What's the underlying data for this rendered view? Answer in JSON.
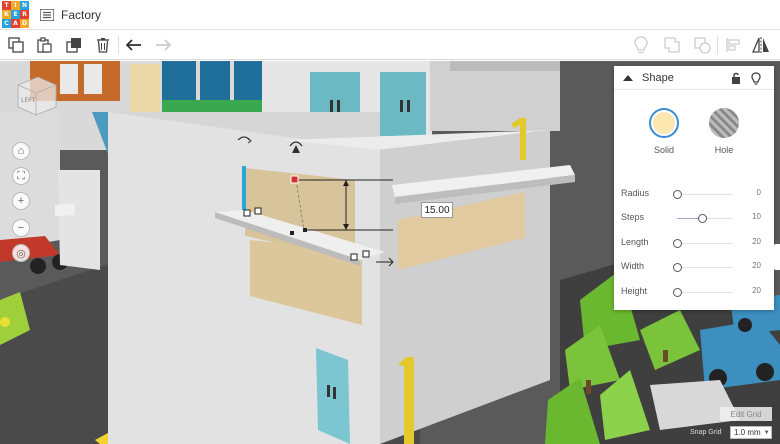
{
  "app": {
    "logo_letters": [
      "T",
      "I",
      "N",
      "K",
      "E",
      "R",
      "C",
      "A",
      "D"
    ],
    "logo_colors": [
      "#e2412f",
      "#f1a928",
      "#26a3dc",
      "#e2412f",
      "#f1a928",
      "#26a3dc",
      "#e2412f",
      "#f1a928",
      "#26a3dc"
    ],
    "design_title": "Factory"
  },
  "toolbar": {
    "left_tools": [
      "copy-icon",
      "paste-icon",
      "duplicate-icon",
      "delete-icon",
      "undo-icon",
      "redo-icon"
    ],
    "right_tools": [
      "light-bulb-icon",
      "group-icon",
      "ungroup-icon",
      "align-icon",
      "mirror-icon"
    ]
  },
  "viewcube": {
    "face_label": "LEFT"
  },
  "view_controls": [
    "home-icon",
    "fit-icon",
    "zoom-in-icon",
    "zoom-out-icon",
    "ortho-icon"
  ],
  "measurement": {
    "value": "15.00"
  },
  "inspector": {
    "title": "Shape",
    "solid_label": "Solid",
    "hole_label": "Hole",
    "solid_color": "#fce7b0",
    "params": [
      {
        "label": "Radius",
        "value": "0",
        "fraction": 0.0
      },
      {
        "label": "Steps",
        "value": "10",
        "fraction": 0.45
      },
      {
        "label": "Length",
        "value": "20",
        "fraction": 0.0
      },
      {
        "label": "Width",
        "value": "20",
        "fraction": 0.0
      },
      {
        "label": "Height",
        "value": "20",
        "fraction": 0.0
      }
    ]
  },
  "grid": {
    "edit_grid_label": "Edit Grid",
    "snap_grid_label": "Snap Grid",
    "snap_value": "1.0 mm"
  }
}
